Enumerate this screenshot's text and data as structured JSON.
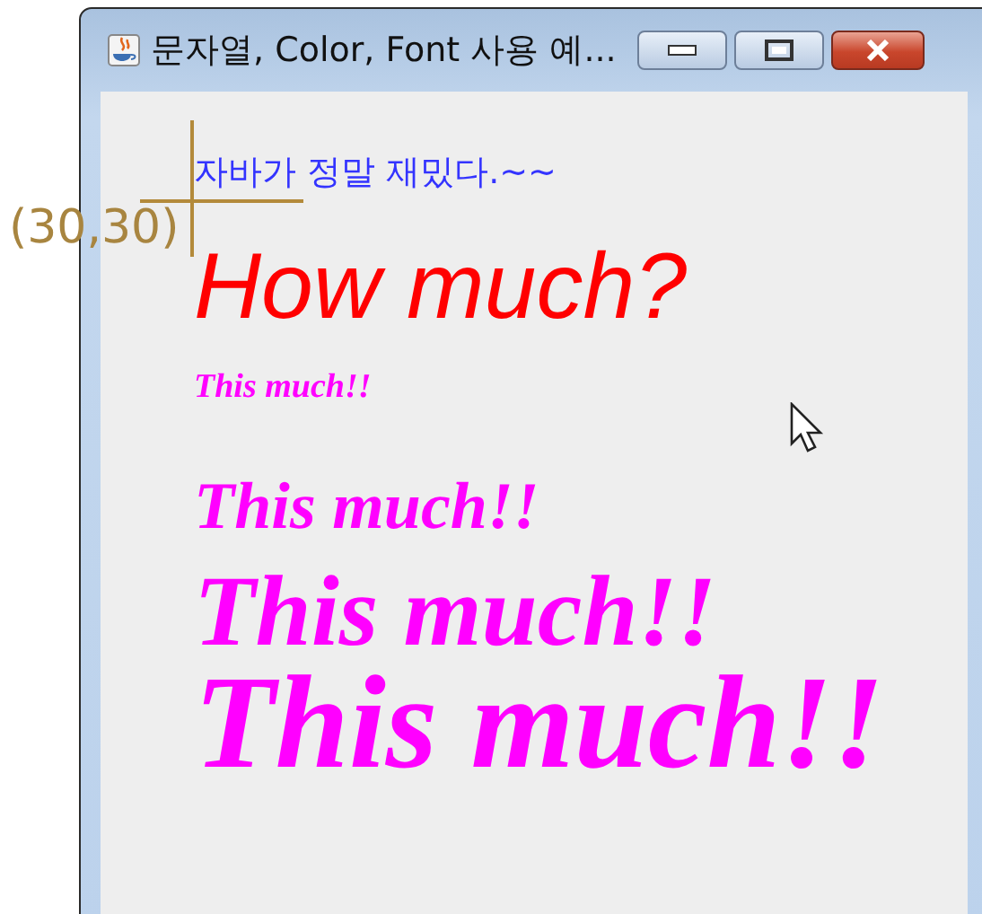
{
  "window": {
    "title": "문자열, Color, Font 사용  예..."
  },
  "annotation": {
    "label": "(30,30)"
  },
  "lines": [
    {
      "text": "자바가 정말 재밌다.~~",
      "kind": "plain",
      "color": "#3333ff"
    },
    {
      "text": "How much?",
      "kind": "italic",
      "color": "#ff0000"
    },
    {
      "text": "This much!!",
      "kind": "decorative",
      "color": "#ff00ff"
    },
    {
      "text": "This much!!",
      "kind": "decorative",
      "color": "#ff00ff"
    },
    {
      "text": "This much!!",
      "kind": "decorative",
      "color": "#ff00ff"
    },
    {
      "text": "This much!!",
      "kind": "decorative",
      "color": "#ff00ff"
    }
  ]
}
